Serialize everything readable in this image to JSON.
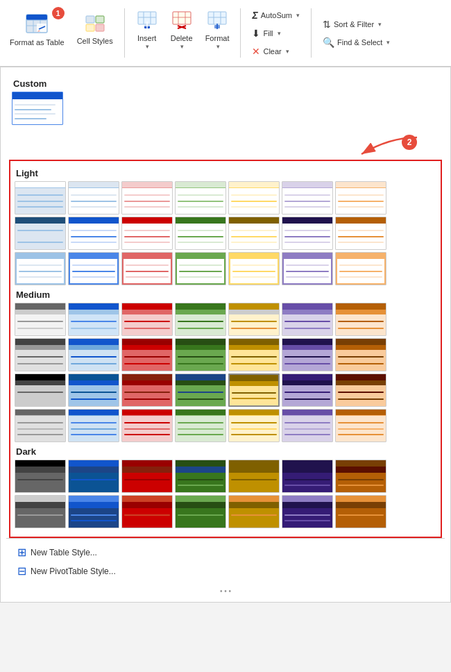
{
  "toolbar": {
    "format_table_label": "Format as\nTable",
    "cell_styles_label": "Cell\nStyles",
    "insert_label": "Insert",
    "delete_label": "Delete",
    "format_label": "Format",
    "autosum_label": "AutoSum",
    "fill_label": "Fill",
    "clear_label": "Clear",
    "sort_filter_label": "Sort &\nFilter",
    "find_select_label": "Find &\nSelect",
    "badge1": "1",
    "badge2": "2"
  },
  "sections": {
    "custom": "Custom",
    "light": "Light",
    "medium": "Medium",
    "dark": "Dark"
  },
  "bottom": {
    "new_table_style": "New Table Style...",
    "new_pivot_style": "New PivotTable Style..."
  },
  "swatches": {
    "light": [
      {
        "header": "#ffffff",
        "rows": [
          "#dce6f1",
          "#ffffff"
        ],
        "border": "#9dc3e6"
      },
      {
        "header": "#dce6f1",
        "rows": [
          "#ffffff",
          "#dce6f1"
        ],
        "border": "#9dc3e6"
      },
      {
        "header": "#f4cccc",
        "rows": [
          "#ffffff",
          "#fce5cd"
        ],
        "border": "#ea9999"
      },
      {
        "header": "#d9ead3",
        "rows": [
          "#ffffff",
          "#d9ead3"
        ],
        "border": "#93c47d"
      },
      {
        "header": "#fff2cc",
        "rows": [
          "#ffffff",
          "#fff2cc"
        ],
        "border": "#ffd966"
      },
      {
        "header": "#d9d2e9",
        "rows": [
          "#ffffff",
          "#d9d2e9"
        ],
        "border": "#b4a7d6"
      },
      {
        "header": "#fce5cd",
        "rows": [
          "#ffffff",
          "#fce5cd"
        ],
        "border": "#f6b26b"
      },
      {
        "header": "#1f4e79",
        "rows": [
          "#dce6f1",
          "#ffffff"
        ],
        "border": "#9dc3e6"
      },
      {
        "header": "#1155cc",
        "rows": [
          "#c9daf8",
          "#ffffff"
        ],
        "border": "#4a86e8"
      },
      {
        "header": "#cc0000",
        "rows": [
          "#f4cccc",
          "#ffffff"
        ],
        "border": "#e06666"
      },
      {
        "header": "#38761d",
        "rows": [
          "#d9ead3",
          "#ffffff"
        ],
        "border": "#6aa84f"
      },
      {
        "header": "#7f6000",
        "rows": [
          "#fff2cc",
          "#ffffff"
        ],
        "border": "#ffd966"
      },
      {
        "header": "#20124d",
        "rows": [
          "#d9d2e9",
          "#ffffff"
        ],
        "border": "#8e7cc3"
      },
      {
        "header": "#b45f06",
        "rows": [
          "#fce5cd",
          "#ffffff"
        ],
        "border": "#e69138"
      },
      {
        "header": "#9dc3e6",
        "rows": [
          "#dce6f1",
          "#ffffff"
        ],
        "border": "#9dc3e6"
      },
      {
        "header": "#4a86e8",
        "rows": [
          "#c9daf8",
          "#ffffff"
        ],
        "border": "#4a86e8"
      },
      {
        "header": "#e06666",
        "rows": [
          "#f4cccc",
          "#ffffff"
        ],
        "border": "#e06666"
      },
      {
        "header": "#6aa84f",
        "rows": [
          "#d9ead3",
          "#ffffff"
        ],
        "border": "#6aa84f"
      },
      {
        "header": "#ffd966",
        "rows": [
          "#fff2cc",
          "#ffffff"
        ],
        "border": "#ffd966"
      },
      {
        "header": "#8e7cc3",
        "rows": [
          "#d9d2e9",
          "#ffffff"
        ],
        "border": "#8e7cc3"
      },
      {
        "header": "#f6b26b",
        "rows": [
          "#fce5cd",
          "#ffffff"
        ],
        "border": "#f6b26b"
      }
    ],
    "medium": [
      {
        "header": "#666666",
        "rows": [
          "#cccccc",
          "#f3f3f3"
        ],
        "border": "#999999"
      },
      {
        "header": "#1155cc",
        "rows": [
          "#9fc5e8",
          "#d0e4f7"
        ],
        "border": "#4a86e8"
      },
      {
        "header": "#cc0000",
        "rows": [
          "#e06666",
          "#f4cccc"
        ],
        "border": "#cc0000"
      },
      {
        "header": "#38761d",
        "rows": [
          "#6aa84f",
          "#d9ead3"
        ],
        "border": "#38761d"
      },
      {
        "header": "#bf9000",
        "rows": [
          "#e69138",
          "#fff2cc"
        ],
        "border": "#bf9000"
      },
      {
        "header": "#674ea7",
        "rows": [
          "#8e7cc3",
          "#d9d2e9"
        ],
        "border": "#674ea7"
      },
      {
        "header": "#b45f06",
        "rows": [
          "#e69138",
          "#fce5cd"
        ],
        "border": "#b45f06"
      },
      {
        "header": "#434343",
        "rows": [
          "#999999",
          "#e0e0e0"
        ],
        "border": "#666666"
      },
      {
        "header": "#1155cc",
        "rows": [
          "#6fa8dc",
          "#cfe2f3"
        ],
        "border": "#1155cc"
      },
      {
        "header": "#990000",
        "rows": [
          "#cc0000",
          "#e06666"
        ],
        "border": "#990000"
      },
      {
        "header": "#274e13",
        "rows": [
          "#38761d",
          "#6aa84f"
        ],
        "border": "#274e13"
      },
      {
        "header": "#7f6000",
        "rows": [
          "#bf9000",
          "#ffe599"
        ],
        "border": "#7f6000"
      },
      {
        "header": "#20124d",
        "rows": [
          "#674ea7",
          "#b4a7d6"
        ],
        "border": "#20124d"
      },
      {
        "header": "#783f04",
        "rows": [
          "#b45f06",
          "#f9cb9c"
        ],
        "border": "#783f04"
      },
      {
        "header": "#000000",
        "rows": [
          "#434343",
          "#cccccc"
        ],
        "border": "#000000"
      },
      {
        "header": "#0b5394",
        "rows": [
          "#1155cc",
          "#9fc5e8"
        ],
        "border": "#0b5394"
      },
      {
        "header": "#85200c",
        "rows": [
          "#990000",
          "#e06666"
        ],
        "border": "#85200c"
      },
      {
        "header": "#1c4587",
        "rows": [
          "#274e13",
          "#6aa84f"
        ],
        "border": "#1c4587"
      },
      {
        "header": "#7f6000",
        "rows": [
          "#bf9000",
          "#ffe599"
        ],
        "border": "#7f6000"
      },
      {
        "header": "#351c75",
        "rows": [
          "#20124d",
          "#b4a7d6"
        ],
        "border": "#351c75"
      },
      {
        "header": "#5b0f00",
        "rows": [
          "#783f04",
          "#f9cb9c"
        ],
        "border": "#5b0f00"
      },
      {
        "header": "#666666",
        "rows": [
          "#999999",
          "#e0e0e0"
        ],
        "border": "#b7b7b7"
      },
      {
        "header": "#1155cc",
        "rows": [
          "#4a86e8",
          "#9fc5e8"
        ],
        "border": "#6fa8dc"
      },
      {
        "header": "#cc0000",
        "rows": [
          "#e06666",
          "#ea9999"
        ],
        "border": "#e06666"
      },
      {
        "header": "#38761d",
        "rows": [
          "#6aa84f",
          "#b6d7a8"
        ],
        "border": "#93c47d"
      },
      {
        "header": "#bf9000",
        "rows": [
          "#e69138",
          "#ffe599"
        ],
        "border": "#ffd966"
      },
      {
        "header": "#674ea7",
        "rows": [
          "#8e7cc3",
          "#c9b9e4"
        ],
        "border": "#b4a7d6"
      },
      {
        "header": "#b45f06",
        "rows": [
          "#e69138",
          "#f9cb9c"
        ],
        "border": "#f6b26b"
      }
    ],
    "dark": [
      {
        "header": "#000000",
        "rows": [
          "#434343",
          "#666666"
        ],
        "border": "#000000"
      },
      {
        "header": "#1155cc",
        "rows": [
          "#1c4587",
          "#0b5394"
        ],
        "border": "#1155cc"
      },
      {
        "header": "#990000",
        "rows": [
          "#85200c",
          "#cc0000"
        ],
        "border": "#990000"
      },
      {
        "header": "#274e13",
        "rows": [
          "#1c4587",
          "#38761d"
        ],
        "border": "#274e13"
      },
      {
        "header": "#7f6000",
        "rows": [
          "#7f6000",
          "#bf9000"
        ],
        "border": "#7f6000"
      },
      {
        "header": "#20124d",
        "rows": [
          "#20124d",
          "#351c75"
        ],
        "border": "#20124d"
      },
      {
        "header": "#783f04",
        "rows": [
          "#5b0f00",
          "#783f04"
        ],
        "border": "#783f04"
      },
      {
        "header": "#cccccc",
        "rows": [
          "#434343",
          "#666666"
        ],
        "border": "#999999"
      },
      {
        "header": "#4a86e8",
        "rows": [
          "#1155cc",
          "#1c4587"
        ],
        "border": "#1155cc"
      },
      {
        "header": "#cc4125",
        "rows": [
          "#990000",
          "#cc0000"
        ],
        "border": "#cc0000"
      },
      {
        "header": "#6aa84f",
        "rows": [
          "#274e13",
          "#38761d"
        ],
        "border": "#38761d"
      },
      {
        "header": "#e69138",
        "rows": [
          "#7f6000",
          "#bf9000"
        ],
        "border": "#bf9000"
      },
      {
        "header": "#8e7cc3",
        "rows": [
          "#20124d",
          "#351c75"
        ],
        "border": "#674ea7"
      },
      {
        "header": "#e69138",
        "rows": [
          "#783f04",
          "#b45f06"
        ],
        "border": "#b45f06"
      }
    ]
  }
}
